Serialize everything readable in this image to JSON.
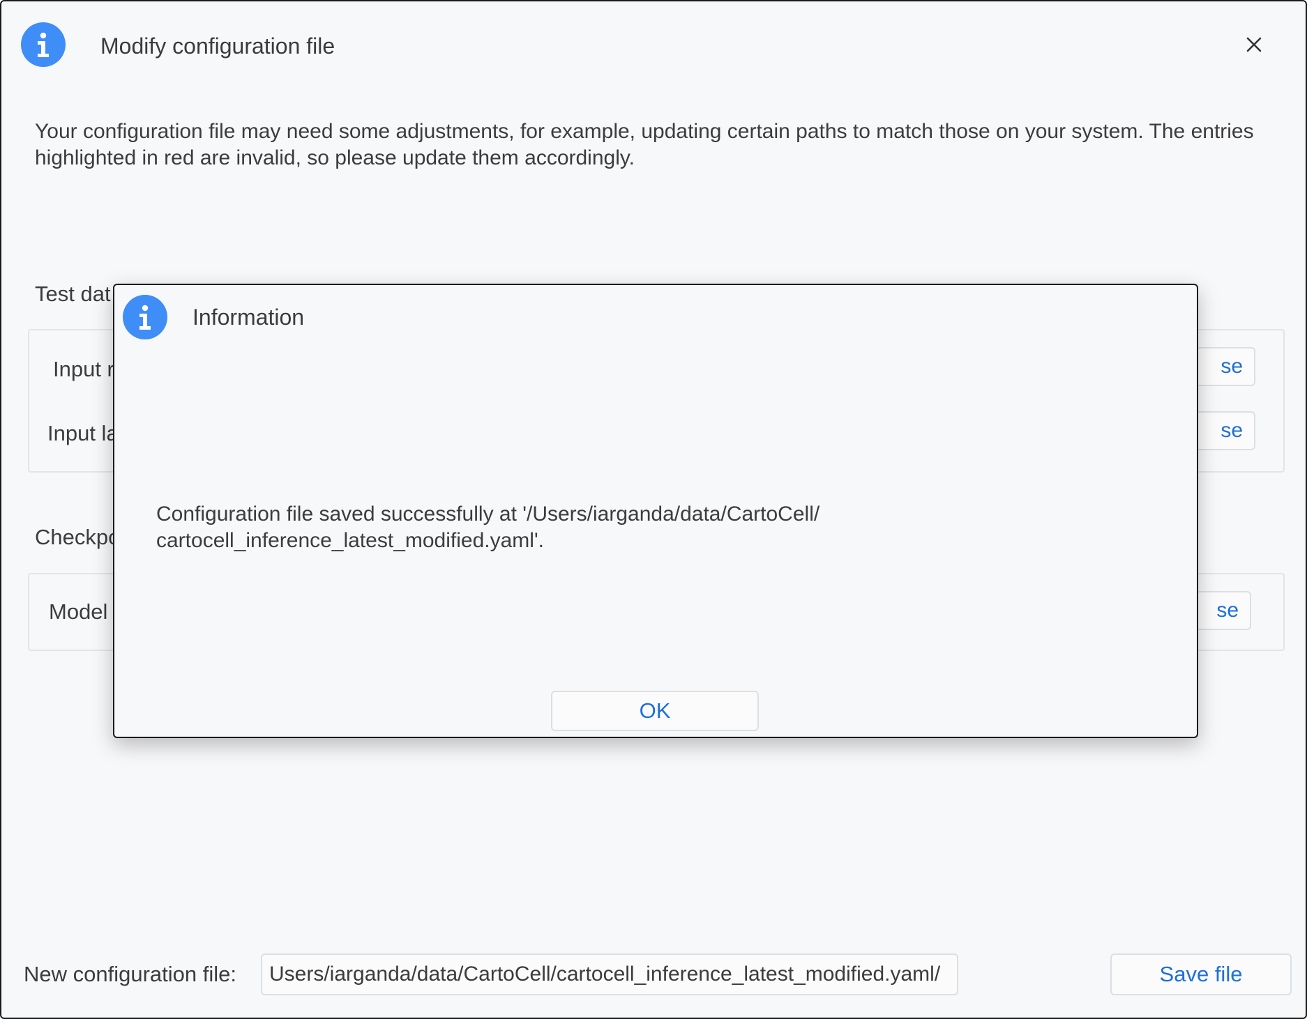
{
  "window": {
    "title": "Modify configuration file",
    "description": "Your configuration file may need some adjustments, for example, updating certain paths to match those on your system. The entries highlighted in red are invalid, so please update them accordingly."
  },
  "sections": {
    "test_data": {
      "label": "Test dat",
      "fields": [
        {
          "label": "Input r",
          "browse": "se"
        },
        {
          "label": "Input la",
          "browse": "se"
        }
      ]
    },
    "checkpoint": {
      "label": "Checkpo",
      "fields": [
        {
          "label": "Model",
          "browse": "se"
        }
      ]
    }
  },
  "footer": {
    "label": "New configuration file:",
    "path_value": "/Users/iarganda/data/CartoCell/cartocell_inference_latest_modified.yaml",
    "save_label": "Save file"
  },
  "dialog": {
    "title": "Information",
    "message_line1": "Configuration file saved successfully at '/Users/iarganda/data/CartoCell/",
    "message_line2": "cartocell_inference_latest_modified.yaml'.",
    "ok_label": "OK"
  },
  "colors": {
    "accent": "#3f8df6",
    "link": "#1e6fd9",
    "background": "#f7f8fa"
  },
  "icons": {
    "header": "info-icon",
    "dialog": "info-icon",
    "close": "close-icon"
  }
}
